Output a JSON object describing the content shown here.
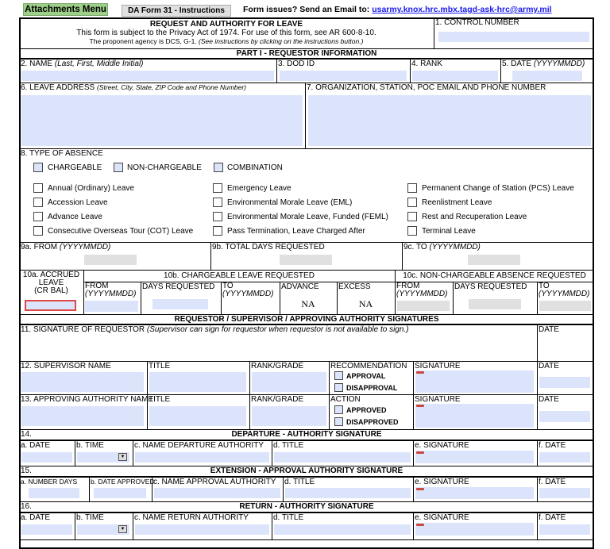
{
  "toolbar": {
    "attachments": "Attachments Menu",
    "instructions": "DA Form 31 - Instructions",
    "issues": "Form issues? Send an Email to:",
    "email": "usarmy.knox.hrc.mbx.tagd-ask-hrc@army.mil"
  },
  "header": {
    "title": "REQUEST AND AUTHORITY FOR LEAVE",
    "privacy": "This form is subject to the Privacy Act of 1974. For use of this form, see AR 600-8-10.",
    "agency": "The proponent agency is DCS, G-1.",
    "agency_note": "(See instructions by clicking on the instructions button.)",
    "control_number": "1. CONTROL NUMBER"
  },
  "part1": {
    "title": "PART I - REQUESTOR  INFORMATION",
    "name": "2. NAME",
    "name_hint": "(Last, First, Middle Initial)",
    "dodid": "3. DOD ID",
    "rank": "4. RANK",
    "date": "5. DATE",
    "date_hint": "(YYYYMMDD)",
    "address": "6. LEAVE ADDRESS",
    "address_hint": "(Street, City, State, ZIP Code and Phone Number)",
    "org": "7. ORGANIZATION, STATION, POC EMAIL AND PHONE NUMBER"
  },
  "absence": {
    "title": "8. TYPE OF ABSENCE",
    "top": [
      "CHARGEABLE",
      "NON-CHARGEABLE",
      "COMBINATION"
    ],
    "col1": [
      "Annual (Ordinary) Leave",
      "Accession Leave",
      "Advance Leave",
      "Consecutive Overseas Tour (COT) Leave"
    ],
    "col2": [
      "Emergency Leave",
      "Environmental Morale Leave (EML)",
      "Environmental Morale Leave, Funded (FEML)",
      "Pass Termination, Leave Charged After"
    ],
    "col3": [
      "Permanent Change of Station (PCS) Leave",
      "Reenlistment Leave",
      "Rest and Recuperation Leave",
      "Terminal Leave"
    ]
  },
  "row9": {
    "from": "9a. FROM",
    "total": "9b. TOTAL DAYS REQUESTED",
    "to": "9c. TO",
    "hint": "(YYYYMMDD)"
  },
  "row10": {
    "accrued": "10a. ACCRUED",
    "leave": "LEAVE",
    "crbal": "(CR BAL)",
    "chargeable": "10b. CHARGEABLE LEAVE REQUESTED",
    "nonchargeable": "10c. NON-CHARGEABLE ABSENCE REQUESTED",
    "from": "FROM",
    "days": "DAYS REQUESTED",
    "to": "TO",
    "hint": "(YYYYMMDD)",
    "advance": "ADVANCE",
    "excess": "EXCESS",
    "advance_value": "NA",
    "excess_value": "NA"
  },
  "signatures": {
    "title": "REQUESTOR / SUPERVISOR / APPROVING AUTHORITY SIGNATURES",
    "requestor": "11.  SIGNATURE OF REQUESTOR",
    "requestor_note": "(Supervisor can sign for requestor when requestor is not available to sign.)",
    "date": "DATE",
    "supervisor": "12. SUPERVISOR NAME",
    "title_col": "TITLE",
    "rank": "RANK/GRADE",
    "recommendation": "RECOMMENDATION",
    "approval": "APPROVAL",
    "disapproval": "DISAPPROVAL",
    "signature": "SIGNATURE",
    "approver": "13. APPROVING AUTHORITY NAME",
    "action": "ACTION",
    "approved": "APPROVED",
    "disapproved": "DISAPPROVED"
  },
  "s14": {
    "num": "14.",
    "title": "DEPARTURE - AUTHORITY SIGNATURE",
    "a": "a. DATE",
    "b": "b. TIME",
    "c": "c. NAME DEPARTURE AUTHORITY",
    "d": "d. TITLE",
    "e": "e. SIGNATURE",
    "f": "f. DATE"
  },
  "s15": {
    "num": "15.",
    "title": "EXTENSION - APPROVAL AUTHORITY SIGNATURE",
    "a": "a. NUMBER DAYS",
    "b": "b. DATE APPROVED",
    "c": "c. NAME APPROVAL AUTHORITY",
    "d": "d. TITLE",
    "e": "e. SIGNATURE",
    "f": "f. DATE"
  },
  "s16": {
    "num": "16.",
    "title": "RETURN - AUTHORITY SIGNATURE",
    "a": "a. DATE",
    "b": "b. TIME",
    "c": "c. NAME RETURN AUTHORITY",
    "d": "d. TITLE",
    "e": "e. SIGNATURE",
    "f": "f. DATE"
  },
  "colors": {
    "field": "#dce4fb",
    "attachments_bg": "#9ed08a",
    "link": "#1a1aee",
    "accrued_border": "#e04848"
  }
}
